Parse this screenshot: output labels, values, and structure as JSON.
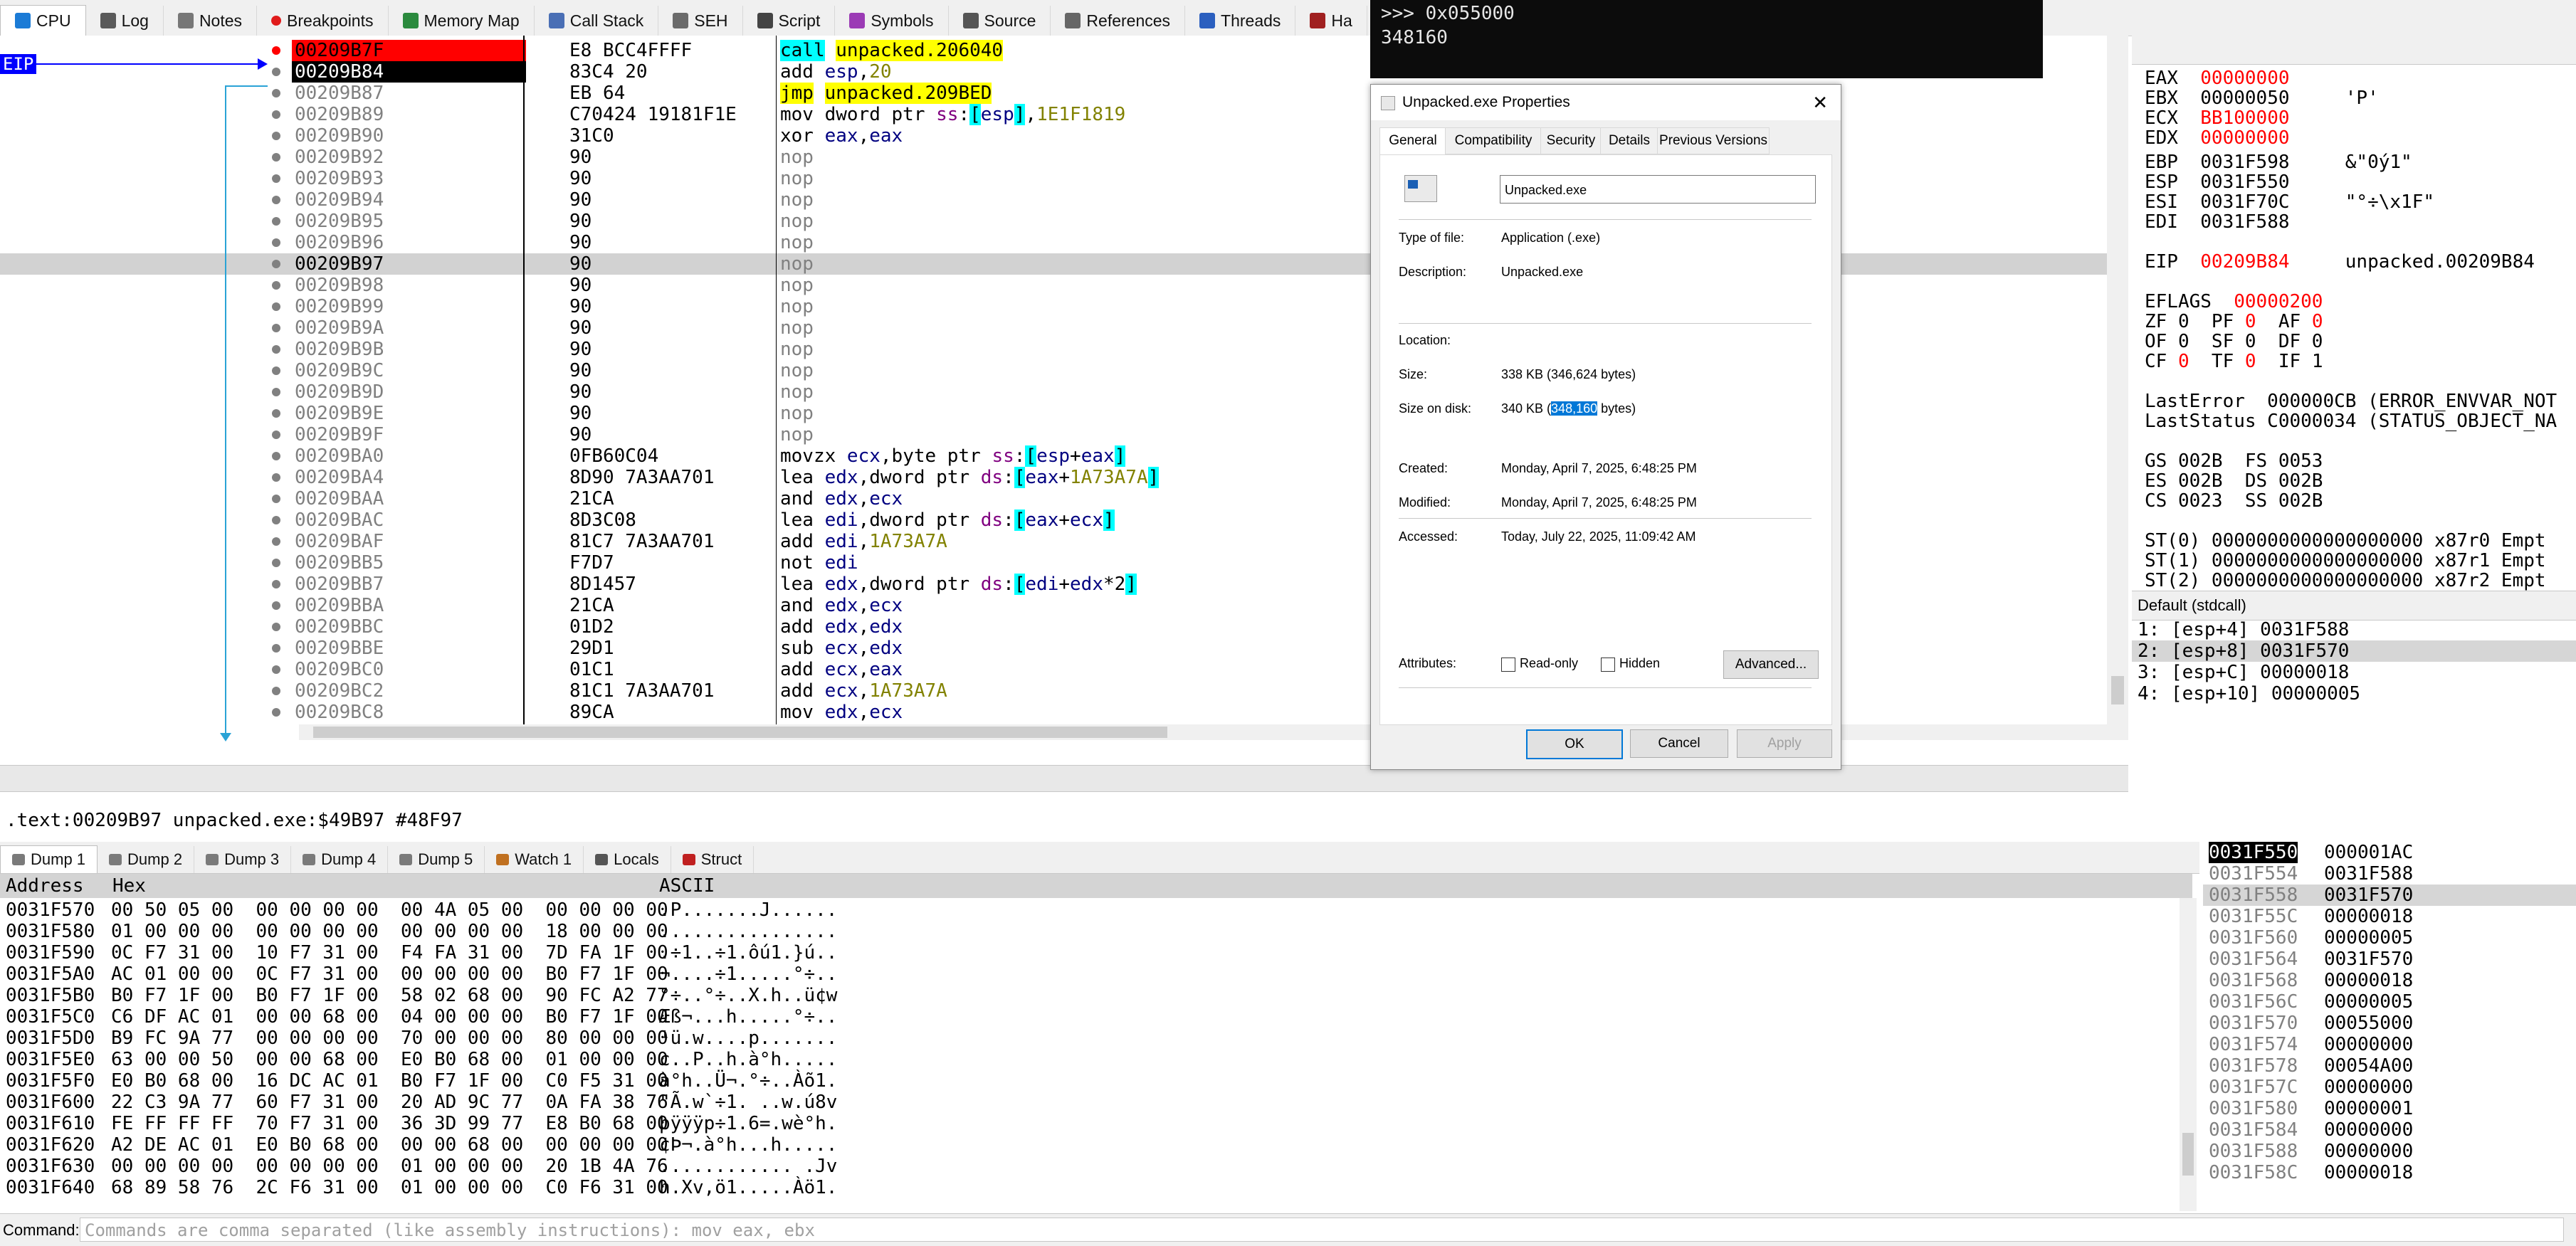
{
  "top_tabs": [
    {
      "label": "CPU",
      "icon": "cpu-icon",
      "active": true
    },
    {
      "label": "Log",
      "icon": "log-icon"
    },
    {
      "label": "Notes",
      "icon": "notes-icon"
    },
    {
      "label": "Breakpoints",
      "icon": "breakpoint-icon"
    },
    {
      "label": "Memory Map",
      "icon": "memory-map-icon"
    },
    {
      "label": "Call Stack",
      "icon": "call-stack-icon"
    },
    {
      "label": "SEH",
      "icon": "seh-icon"
    },
    {
      "label": "Script",
      "icon": "script-icon"
    },
    {
      "label": "Symbols",
      "icon": "symbols-icon"
    },
    {
      "label": "Source",
      "icon": "source-icon"
    },
    {
      "label": "References",
      "icon": "references-icon"
    },
    {
      "label": "Threads",
      "icon": "threads-icon"
    },
    {
      "label": "Ha",
      "icon": "handles-icon"
    }
  ],
  "eip_label": "EIP",
  "disasm": [
    {
      "addr": "00209B7F",
      "bytes": "E8 BCC4FFFF",
      "instr": "call unpacked.206040",
      "style": "bp"
    },
    {
      "addr": "00209B84",
      "bytes": "83C4 20",
      "instr": "add esp,20",
      "style": "eip"
    },
    {
      "addr": "00209B87",
      "bytes": "EB 64",
      "instr": "jmp unpacked.209BED"
    },
    {
      "addr": "00209B89",
      "bytes": "C70424 19181F1E",
      "instr": "mov dword ptr ss:[esp],1E1F1819"
    },
    {
      "addr": "00209B90",
      "bytes": "31C0",
      "instr": "xor eax,eax"
    },
    {
      "addr": "00209B92",
      "bytes": "90",
      "instr": "nop"
    },
    {
      "addr": "00209B93",
      "bytes": "90",
      "instr": "nop"
    },
    {
      "addr": "00209B94",
      "bytes": "90",
      "instr": "nop"
    },
    {
      "addr": "00209B95",
      "bytes": "90",
      "instr": "nop"
    },
    {
      "addr": "00209B96",
      "bytes": "90",
      "instr": "nop"
    },
    {
      "addr": "00209B97",
      "bytes": "90",
      "instr": "nop",
      "style": "sel"
    },
    {
      "addr": "00209B98",
      "bytes": "90",
      "instr": "nop"
    },
    {
      "addr": "00209B99",
      "bytes": "90",
      "instr": "nop"
    },
    {
      "addr": "00209B9A",
      "bytes": "90",
      "instr": "nop"
    },
    {
      "addr": "00209B9B",
      "bytes": "90",
      "instr": "nop"
    },
    {
      "addr": "00209B9C",
      "bytes": "90",
      "instr": "nop"
    },
    {
      "addr": "00209B9D",
      "bytes": "90",
      "instr": "nop"
    },
    {
      "addr": "00209B9E",
      "bytes": "90",
      "instr": "nop"
    },
    {
      "addr": "00209B9F",
      "bytes": "90",
      "instr": "nop"
    },
    {
      "addr": "00209BA0",
      "bytes": "0FB60C04",
      "instr": "movzx ecx,byte ptr ss:[esp+eax]"
    },
    {
      "addr": "00209BA4",
      "bytes": "8D90 7A3AA701",
      "instr": "lea edx,dword ptr ds:[eax+1A73A7A]"
    },
    {
      "addr": "00209BAA",
      "bytes": "21CA",
      "instr": "and edx,ecx"
    },
    {
      "addr": "00209BAC",
      "bytes": "8D3C08",
      "instr": "lea edi,dword ptr ds:[eax+ecx]"
    },
    {
      "addr": "00209BAF",
      "bytes": "81C7 7A3AA701",
      "instr": "add edi,1A73A7A"
    },
    {
      "addr": "00209BB5",
      "bytes": "F7D7",
      "instr": "not edi"
    },
    {
      "addr": "00209BB7",
      "bytes": "8D1457",
      "instr": "lea edx,dword ptr ds:[edi+edx*2]"
    },
    {
      "addr": "00209BBA",
      "bytes": "21CA",
      "instr": "and edx,ecx"
    },
    {
      "addr": "00209BBC",
      "bytes": "01D2",
      "instr": "add edx,edx"
    },
    {
      "addr": "00209BBE",
      "bytes": "29D1",
      "instr": "sub ecx,edx"
    },
    {
      "addr": "00209BC0",
      "bytes": "01C1",
      "instr": "add ecx,eax"
    },
    {
      "addr": "00209BC2",
      "bytes": "81C1 7A3AA701",
      "instr": "add ecx,1A73A7A"
    },
    {
      "addr": "00209BC8",
      "bytes": "89CA",
      "instr": "mov edx,ecx"
    }
  ],
  "info_line": ".text:00209B97 unpacked.exe:$49B97 #48F97",
  "console": {
    "line1": ">>> 0x055000",
    "line2": "348160"
  },
  "dialog": {
    "title": "Unpacked.exe Properties",
    "tabs": [
      "General",
      "Compatibility",
      "Security",
      "Details",
      "Previous Versions"
    ],
    "filename": "Unpacked.exe",
    "rows": [
      {
        "label": "Type of file:",
        "value": "Application (.exe)"
      },
      {
        "label": "Description:",
        "value": "Unpacked.exe"
      },
      {
        "label": "Location:",
        "value": ""
      },
      {
        "label": "Size:",
        "value": "338 KB (346,624 bytes)"
      },
      {
        "label": "Size on disk:",
        "value_pre": "340 KB (",
        "value_sel": "348,160",
        "value_post": " bytes)"
      },
      {
        "label": "Created:",
        "value": "Monday, April 7, 2025, 6:48:25 PM"
      },
      {
        "label": "Modified:",
        "value": "Monday, April 7, 2025, 6:48:25 PM"
      },
      {
        "label": "Accessed:",
        "value": "Today, July 22, 2025, 11:09:42 AM"
      }
    ],
    "attributes_label": "Attributes:",
    "readonly_label": "Read-only",
    "hidden_label": "Hidden",
    "advanced_label": "Advanced...",
    "ok_label": "OK",
    "cancel_label": "Cancel",
    "apply_label": "Apply"
  },
  "registers": {
    "lines": [
      {
        "name": "EAX",
        "value": "00000000",
        "changed": true,
        "comment": ""
      },
      {
        "name": "EBX",
        "value": "00000050",
        "changed": false,
        "comment": "'P'"
      },
      {
        "name": "ECX",
        "value": "BB100000",
        "changed": true,
        "comment": ""
      },
      {
        "name": "EDX",
        "value": "00000000",
        "changed": true,
        "comment": ""
      },
      {
        "name": "EBP",
        "value": "0031F598",
        "changed": false,
        "comment": "&\"0ý1\""
      },
      {
        "name": "ESP",
        "value": "0031F550",
        "changed": false,
        "comment": ""
      },
      {
        "name": "ESI",
        "value": "0031F70C",
        "changed": false,
        "comment": "\"°÷\\x1F\""
      },
      {
        "name": "EDI",
        "value": "0031F588",
        "changed": false,
        "comment": ""
      }
    ],
    "eip": {
      "name": "EIP",
      "value": "00209B84",
      "comment": "unpacked.00209B84"
    },
    "eflags": {
      "name": "EFLAGS",
      "value": "00000200"
    },
    "flags": [
      "ZF 0  PF 0  AF 0",
      "OF 0  SF 0  DF 0",
      "CF 0  TF 0  IF 1"
    ],
    "last_error": "LastError  000000CB (ERROR_ENVVAR_NOT",
    "last_status": "LastStatus C0000034 (STATUS_OBJECT_NA",
    "segs": [
      "GS 002B  FS 0053",
      "ES 002B  DS 002B",
      "CS 0023  SS 002B"
    ],
    "st": [
      "ST(0) 0000000000000000000 x87r0 Empt",
      "ST(1) 0000000000000000000 x87r1 Empt",
      "ST(2) 0000000000000000000 x87r2 Empt"
    ]
  },
  "callconv": "Default (stdcall)",
  "args": [
    "1: [esp+4] 0031F588",
    "2: [esp+8] 0031F570",
    "3: [esp+C] 00000018",
    "4: [esp+10] 00000005"
  ],
  "dump_tabs": [
    "Dump 1",
    "Dump 2",
    "Dump 3",
    "Dump 4",
    "Dump 5",
    "Watch 1",
    "Locals",
    "Struct"
  ],
  "dump_head": {
    "address": "Address",
    "hex": "Hex",
    "ascii": "ASCII"
  },
  "dump": [
    {
      "addr": "0031F570",
      "hex": "00 50 05 00  00 00 00 00  00 4A 05 00  00 00 00 00",
      "ascii": ".P.......J......"
    },
    {
      "addr": "0031F580",
      "hex": "01 00 00 00  00 00 00 00  00 00 00 00  18 00 00 00",
      "ascii": "................"
    },
    {
      "addr": "0031F590",
      "hex": "0C F7 31 00  10 F7 31 00  F4 FA 31 00  7D FA 1F 00",
      "ascii": ".÷1..÷1.ôú1.}ú.."
    },
    {
      "addr": "0031F5A0",
      "hex": "AC 01 00 00  0C F7 31 00  00 00 00 00  B0 F7 1F 00",
      "ascii": "¬....÷1.....°÷.."
    },
    {
      "addr": "0031F5B0",
      "hex": "B0 F7 1F 00  B0 F7 1F 00  58 02 68 00  90 FC A2 77",
      "ascii": "°÷..°÷..X.h..ü¢w"
    },
    {
      "addr": "0031F5C0",
      "hex": "C6 DF AC 01  00 00 68 00  04 00 00 00  B0 F7 1F 00",
      "ascii": "Æß¬...h.....°÷.."
    },
    {
      "addr": "0031F5D0",
      "hex": "B9 FC 9A 77  00 00 00 00  70 00 00 00  80 00 00 00",
      "ascii": "¹ü.w....p......."
    },
    {
      "addr": "0031F5E0",
      "hex": "63 00 00 50  00 00 68 00  E0 B0 68 00  01 00 00 00",
      "ascii": "c..P..h.à°h....."
    },
    {
      "addr": "0031F5F0",
      "hex": "E0 B0 68 00  16 DC AC 01  B0 F7 1F 00  C0 F5 31 00",
      "ascii": "à°h..Ü¬.°÷..Àõ1."
    },
    {
      "addr": "0031F600",
      "hex": "22 C3 9A 77  60 F7 31 00  20 AD 9C 77  0A FA 38 76",
      "ascii": "\"Ã.w`÷1. ..w.ú8v"
    },
    {
      "addr": "0031F610",
      "hex": "FE FF FF FF  70 F7 31 00  36 3D 99 77  E8 B0 68 00",
      "ascii": "þÿÿÿp÷1.6=.wè°h."
    },
    {
      "addr": "0031F620",
      "hex": "A2 DE AC 01  E0 B0 68 00  00 00 68 00  00 00 00 00",
      "ascii": "¢Þ¬.à°h...h....."
    },
    {
      "addr": "0031F630",
      "hex": "00 00 00 00  00 00 00 00  01 00 00 00  20 1B 4A 76",
      "ascii": "............ .Jv"
    },
    {
      "addr": "0031F640",
      "hex": "68 89 58 76  2C F6 31 00  01 00 00 00  C0 F6 31 00",
      "ascii": "h.Xv,ö1.....Àö1."
    }
  ],
  "stack": [
    {
      "addr": "0031F550",
      "val": "000001AC",
      "top": true
    },
    {
      "addr": "0031F554",
      "val": "0031F588"
    },
    {
      "addr": "0031F558",
      "val": "0031F570",
      "sel": true
    },
    {
      "addr": "0031F55C",
      "val": "00000018"
    },
    {
      "addr": "0031F560",
      "val": "00000005"
    },
    {
      "addr": "0031F564",
      "val": "0031F570"
    },
    {
      "addr": "0031F568",
      "val": "00000018"
    },
    {
      "addr": "0031F56C",
      "val": "00000005"
    },
    {
      "addr": "0031F570",
      "val": "00055000"
    },
    {
      "addr": "0031F574",
      "val": "00000000"
    },
    {
      "addr": "0031F578",
      "val": "00054A00"
    },
    {
      "addr": "0031F57C",
      "val": "00000000"
    },
    {
      "addr": "0031F580",
      "val": "00000001"
    },
    {
      "addr": "0031F584",
      "val": "00000000"
    },
    {
      "addr": "0031F588",
      "val": "00000000"
    },
    {
      "addr": "0031F58C",
      "val": "00000018"
    }
  ],
  "command": {
    "label": "Command:",
    "placeholder": "Commands are comma separated (like assembly instructions): mov eax, ebx"
  }
}
